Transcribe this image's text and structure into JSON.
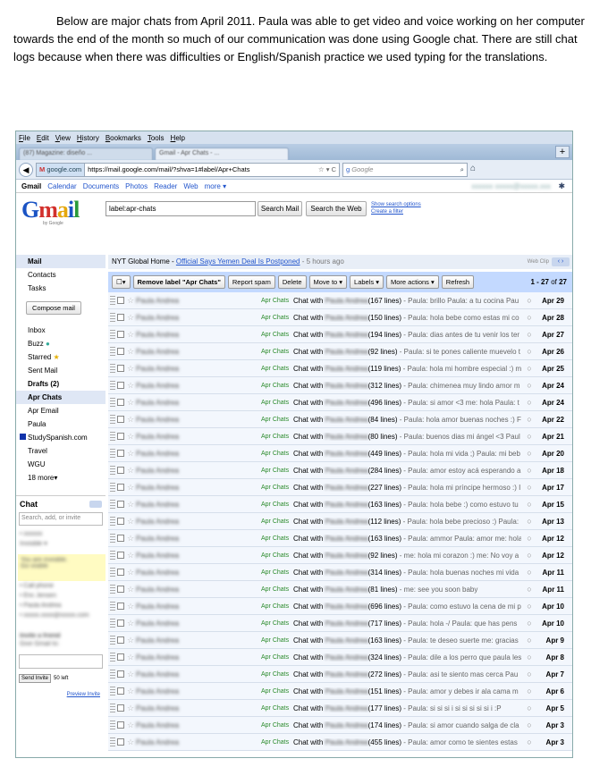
{
  "intro_text": "Below are major chats from April 2011.  Paula was able to get video and voice working on her computer towards the end of the month so much of our communication was done using Google chat.  There are still chat logs because when there was difficulties or English/Spanish practice we used typing for the translations.",
  "browser": {
    "menu": [
      "File",
      "Edit",
      "View",
      "History",
      "Bookmarks",
      "Tools",
      "Help"
    ],
    "tabs": [
      "(87) Magazine: diseño ...",
      "Gmail - Apr Chats - ..."
    ],
    "site": "google.com",
    "url": "https://mail.google.com/mail/?shva=1#label/Apr+Chats",
    "search_placeholder": "Google"
  },
  "gmail": {
    "topnav": [
      "Gmail",
      "Calendar",
      "Documents",
      "Photos",
      "Reader",
      "Web",
      "more ▾"
    ],
    "search_value": "label:apr-chats",
    "search_mail": "Search Mail",
    "search_web": "Search the Web",
    "show_options": "Show search options",
    "create_filter": "Create a filter",
    "sidebar": {
      "top": [
        "Mail",
        "Contacts",
        "Tasks"
      ],
      "compose": "Compose mail",
      "folders": [
        "Inbox",
        "Buzz",
        "Starred",
        "Sent Mail",
        "Drafts (2)"
      ],
      "labels": [
        "Apr Chats",
        "Apr Email",
        "Paula",
        "StudySpanish.com",
        "Travel",
        "WGU",
        "18 more▾"
      ],
      "chat_title": "Chat",
      "chat_search": "Search, add, or invite",
      "send_invite": "Send Invite",
      "invites_left": "50 left",
      "preview_invite": "Preview Invite"
    },
    "webclip": {
      "source": "NYT Global Home - ",
      "headline": "Official Says Yemen Deal Is Postponed",
      "ago": " - 5 hours ago",
      "tag": "Web Clip"
    },
    "toolbar": {
      "remove_label": "Remove label \"Apr Chats\"",
      "report_spam": "Report spam",
      "delete": "Delete",
      "move_to": "Move to ▾",
      "labels": "Labels ▾",
      "more_actions": "More actions ▾",
      "refresh": "Refresh",
      "count_range": "1 - 27",
      "count_of": " of ",
      "count_total": "27"
    },
    "label_tag": "Apr Chats",
    "chat_with": "Chat with",
    "rows": [
      {
        "lines": "(167 lines)",
        "snippet": " - Paula: brillo Paula: a tu cocina Pau",
        "date": "Apr 29"
      },
      {
        "lines": "(150 lines)",
        "snippet": " - Paula: hola bebe como estas mi co",
        "date": "Apr 28"
      },
      {
        "lines": "(194 lines)",
        "snippet": " - Paula: dias antes de tu venir los ter",
        "date": "Apr 27"
      },
      {
        "lines": "(92 lines)",
        "snippet": " - Paula: si te pones caliente muevelo t",
        "date": "Apr 26"
      },
      {
        "lines": "(119 lines)",
        "snippet": " - Paula: hola mi hombre especial :) m",
        "date": "Apr 25"
      },
      {
        "lines": "(312 lines)",
        "snippet": " - Paula: chimenea muy lindo amor m",
        "date": "Apr 24"
      },
      {
        "lines": "(496 lines)",
        "snippet": " - Paula: si amor <3 me: hola Paula: t",
        "date": "Apr 24"
      },
      {
        "lines": "(84 lines)",
        "snippet": " - Paula: hola amor buenas noches :) F",
        "date": "Apr 22"
      },
      {
        "lines": "(80 lines)",
        "snippet": " - Paula: buenos dias mi ángel <3 Paul",
        "date": "Apr 21"
      },
      {
        "lines": "(449 lines)",
        "snippet": " - Paula: hola mi vida ;) Paula: mi beb",
        "date": "Apr 20"
      },
      {
        "lines": "(284 lines)",
        "snippet": " - Paula: amor estoy acá esperando a",
        "date": "Apr 18"
      },
      {
        "lines": "(227 lines)",
        "snippet": " - Paula: hola mi príncipe hermoso :) I",
        "date": "Apr 17"
      },
      {
        "lines": "(163 lines)",
        "snippet": " - Paula: hola bebe :) como estuvo tu",
        "date": "Apr 15"
      },
      {
        "lines": "(112 lines)",
        "snippet": " - Paula: hola bebe precioso :) Paula:",
        "date": "Apr 13"
      },
      {
        "lines": "(163 lines)",
        "snippet": " - Paula: ammor Paula: amor me: hola",
        "date": "Apr 12"
      },
      {
        "lines": "(92 lines)",
        "snippet": " - me: hola mi corazon :) me: No voy a",
        "date": "Apr 12"
      },
      {
        "lines": "(314 lines)",
        "snippet": " - Paula: hola buenas noches mi vida",
        "date": "Apr 11"
      },
      {
        "lines": "(81 lines)",
        "snippet": " - me: see you soon baby",
        "date": "Apr 11"
      },
      {
        "lines": "(696 lines)",
        "snippet": " - Paula: como estuvo la cena de mi p",
        "date": "Apr 10"
      },
      {
        "lines": "(717 lines)",
        "snippet": " - Paula: hola -/ Paula: que has pens",
        "date": "Apr 10"
      },
      {
        "lines": "(163 lines)",
        "snippet": " - Paula: te deseo suerte me: gracias",
        "date": "Apr 9"
      },
      {
        "lines": "(324 lines)",
        "snippet": " - Paula: dile a los perro que paula les",
        "date": "Apr 8"
      },
      {
        "lines": "(272 lines)",
        "snippet": " - Paula: asi te siento mas cerca Pau",
        "date": "Apr 7"
      },
      {
        "lines": "(151 lines)",
        "snippet": " - Paula: amor y debes ir ala cama m",
        "date": "Apr 6"
      },
      {
        "lines": "(177 lines)",
        "snippet": " - Paula: si si si i si si si si si i :P",
        "date": "Apr 5"
      },
      {
        "lines": "(174 lines)",
        "snippet": " - Paula: si amor cuando salga de cla",
        "date": "Apr 3"
      },
      {
        "lines": "(455 lines)",
        "snippet": " - Paula: amor como te sientes estas",
        "date": "Apr 3"
      }
    ]
  }
}
